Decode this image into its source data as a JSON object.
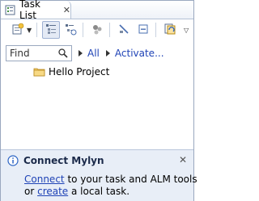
{
  "tab": {
    "title": "Task List",
    "close_symbol": "✕",
    "icon": "task-list-icon"
  },
  "toolbar": {
    "buttons": [
      {
        "name": "new-task-button",
        "icon": "new-task-icon"
      },
      {
        "name": "new-task-dropdown",
        "icon": "chevron-down-icon"
      },
      {
        "name": "categorized-view-button",
        "icon": "categorized-icon",
        "pressed": true
      },
      {
        "name": "scheduled-view-button",
        "icon": "scheduled-icon"
      },
      {
        "name": "focus-workweek-button",
        "icon": "focus-icon"
      },
      {
        "name": "hide-completed-button",
        "icon": "hide-completed-icon"
      },
      {
        "name": "collapse-all-button",
        "icon": "collapse-all-icon"
      },
      {
        "name": "synchronize-button",
        "icon": "synchronize-icon"
      },
      {
        "name": "view-menu-button",
        "icon": "chevron-down-icon"
      }
    ]
  },
  "find": {
    "placeholder": "Find",
    "all_label": "All",
    "activate_label": "Activate..."
  },
  "tasks": [
    {
      "label": "Hello Project",
      "icon": "folder-icon"
    }
  ],
  "connect": {
    "title": "Connect Mylyn",
    "close_symbol": "✕",
    "connect_link": "Connect",
    "line1_rest": " to your task and ALM tools",
    "line2_prefix": "or ",
    "create_link": "create",
    "line2_rest": " a local task."
  },
  "colors": {
    "link": "#1f43b6",
    "folder": "#e8b84a",
    "info": "#2b64c4",
    "panel_bg": "#e8eef7"
  }
}
